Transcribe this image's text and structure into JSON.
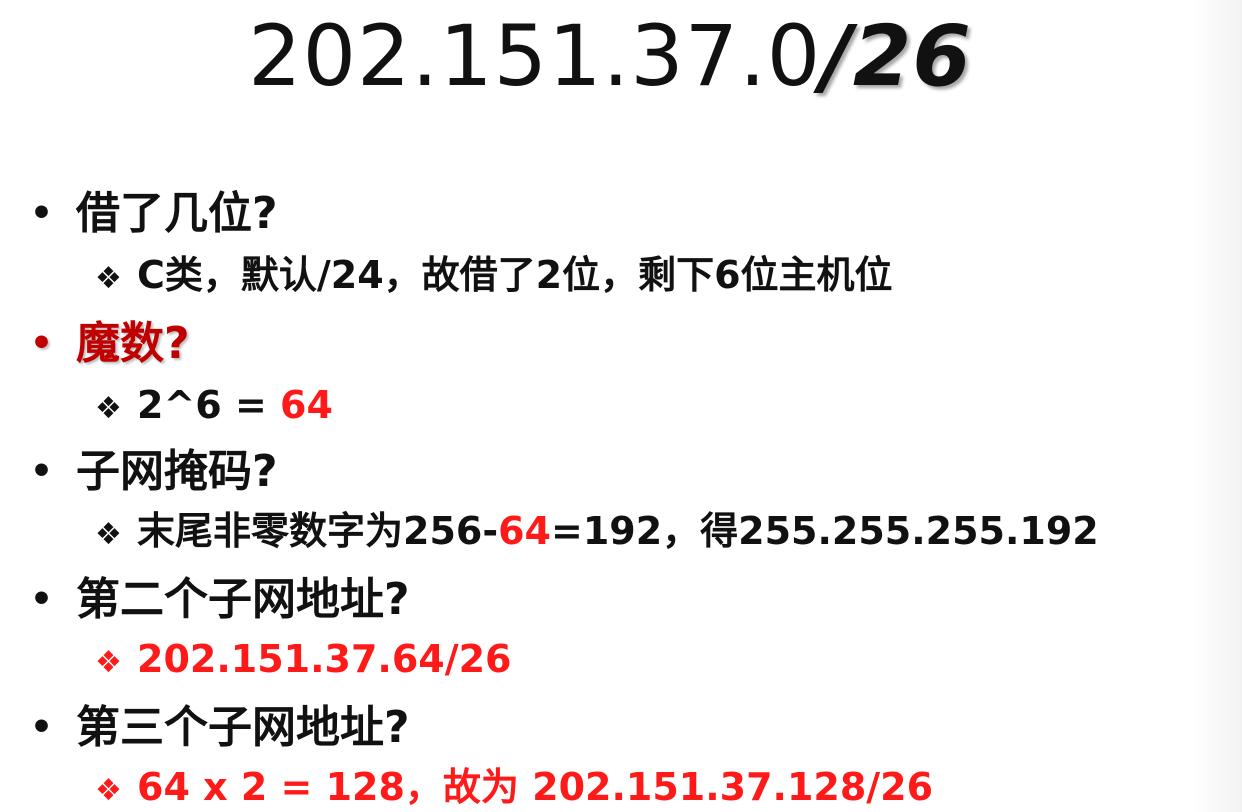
{
  "title": {
    "main": "202.151.37.0",
    "suffix": "/26"
  },
  "items": [
    {
      "question": "借了几位?",
      "answer": "C类，默认/24，故借了2位，剩下6位主机位"
    },
    {
      "question": "魔数?",
      "answer_prefix": "2^6 = ",
      "answer_highlight": "64"
    },
    {
      "question": "子网掩码?",
      "answer_prefix": "末尾非零数字为256-",
      "answer_highlight": "64",
      "answer_suffix": "=192，得255.255.255.192"
    },
    {
      "question": "第二个子网地址?",
      "answer": "202.151.37.64/26"
    },
    {
      "question": "第三个子网地址?",
      "answer": "64 x 2 = 128，故为 202.151.37.128/26"
    }
  ],
  "symbols": {
    "bullet": "•",
    "diamond": "❖"
  },
  "colors": {
    "accent_red": "#ff1a1a",
    "question_red": "#c00000",
    "text": "#111111"
  }
}
